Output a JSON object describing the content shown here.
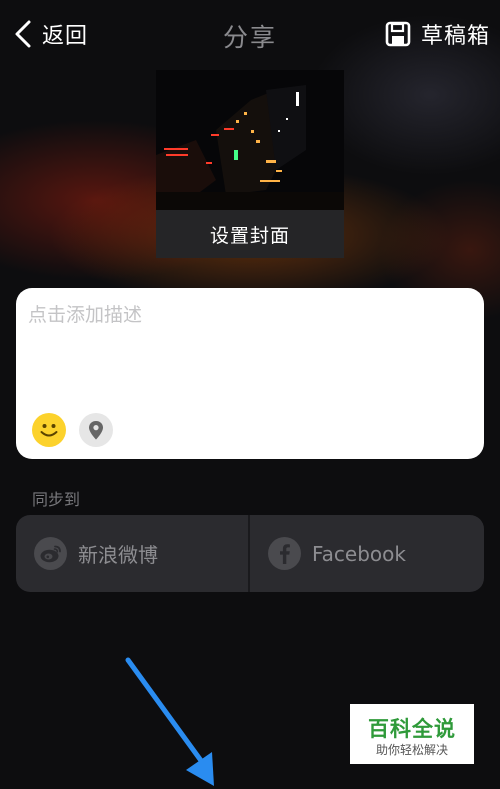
{
  "header": {
    "back_label": "返回",
    "title": "分享",
    "drafts_label": "草稿箱"
  },
  "cover": {
    "label": "设置封面"
  },
  "description": {
    "placeholder": "点击添加描述",
    "value": ""
  },
  "sync": {
    "label": "同步到",
    "options": [
      {
        "label": "新浪微博",
        "icon": "weibo-icon"
      },
      {
        "label": "Facebook",
        "icon": "facebook-icon"
      }
    ]
  },
  "watermark": {
    "title": "百科全说",
    "subtitle": "助你轻松解决"
  },
  "colors": {
    "accent_yellow": "#fcd22c",
    "arrow_blue": "#2a8cf0",
    "watermark_green": "#2f9a3a",
    "title_gray": "#8a8a8e"
  }
}
